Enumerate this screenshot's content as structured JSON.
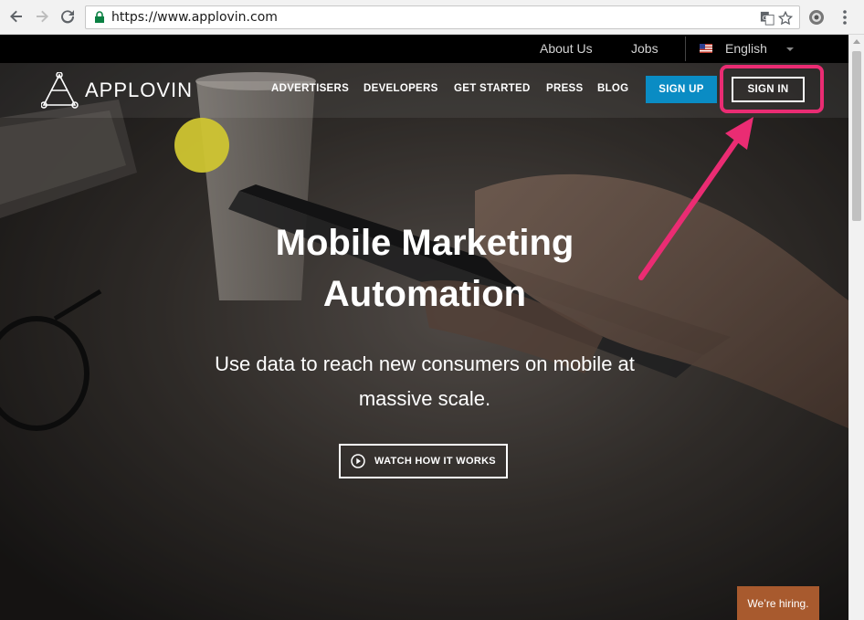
{
  "browser": {
    "url": "https://www.applovin.com",
    "icons": [
      "back-icon",
      "forward-icon",
      "reload-icon",
      "lock-icon",
      "translate-icon",
      "star-icon",
      "extension-icon",
      "menu-icon"
    ]
  },
  "topbar": {
    "about": "About Us",
    "jobs": "Jobs",
    "language": "English"
  },
  "header": {
    "logo": "APPLOVIN",
    "nav": [
      "ADVERTISERS",
      "DEVELOPERS",
      "GET STARTED",
      "PRESS",
      "BLOG"
    ],
    "signup": "SIGN UP",
    "signin": "SIGN IN"
  },
  "hero": {
    "title_line1": "Mobile Marketing",
    "title_line2": "Automation",
    "subtitle_line1": "Use data to reach new consumers on mobile at",
    "subtitle_line2": "massive scale.",
    "watch": "WATCH HOW IT WORKS"
  },
  "hiring": "We’re hiring.",
  "colors": {
    "accent_blue": "#0a8cc4",
    "annotation_pink": "#ea2c73",
    "yellow_dot": "#cfc531",
    "hiring_bg": "#a85a2e"
  }
}
